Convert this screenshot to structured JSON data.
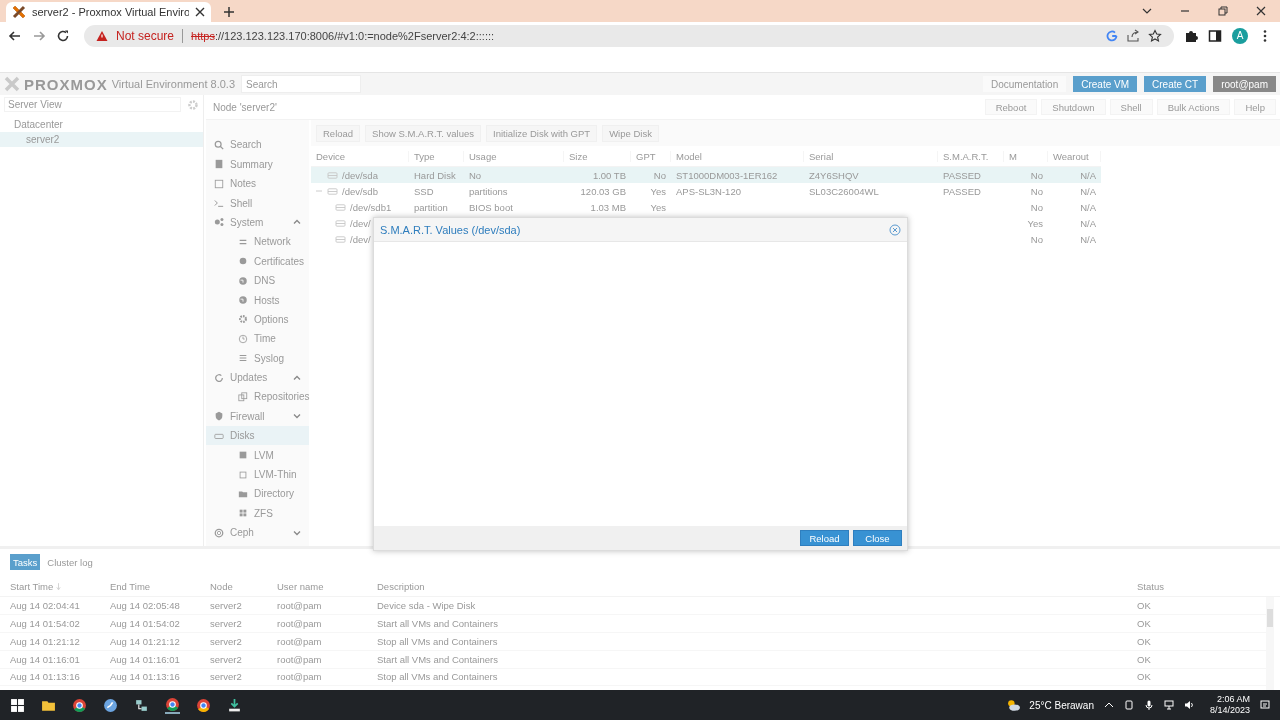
{
  "browser": {
    "tab_title": "server2 - Proxmox Virtual Enviro",
    "security": "Not secure",
    "url_scheme": "https",
    "url_rest": "://123.123.123.170:8006/#v1:0:=node%2Fserver2:4:2::::::",
    "avatar": "A"
  },
  "header": {
    "logo": "PROXMOX",
    "product": "Virtual Environment 8.0.3",
    "search": {
      "placeholder": "Search"
    },
    "buttons": [
      {
        "label": "Documentation",
        "kind": "plain"
      },
      {
        "label": "Create VM",
        "kind": "primary"
      },
      {
        "label": "Create CT",
        "kind": "primary"
      },
      {
        "label": "root@pam",
        "kind": "user"
      }
    ]
  },
  "tree": {
    "view": "Server View",
    "items": [
      {
        "label": "Datacenter",
        "selected": false,
        "children": [
          {
            "label": "server2",
            "selected": true
          }
        ]
      }
    ]
  },
  "node": {
    "title": "Node 'server2'",
    "buttons": [
      "Reboot",
      "Shutdown",
      "Shell",
      "Bulk Actions",
      "Help"
    ]
  },
  "nav": {
    "items": [
      {
        "label": "Search",
        "selected": false
      },
      {
        "label": "Summary",
        "selected": false
      },
      {
        "label": "Notes",
        "selected": false
      },
      {
        "label": "Shell",
        "selected": false
      },
      {
        "label": "System",
        "selected": false,
        "expanded": true,
        "children": [
          {
            "label": "Network",
            "selected": false
          },
          {
            "label": "Certificates",
            "selected": false
          },
          {
            "label": "DNS",
            "selected": false
          },
          {
            "label": "Hosts",
            "selected": false
          },
          {
            "label": "Options",
            "selected": false
          },
          {
            "label": "Time",
            "selected": false
          },
          {
            "label": "Syslog",
            "selected": false
          }
        ]
      },
      {
        "label": "Updates",
        "selected": false,
        "expanded": true,
        "children": [
          {
            "label": "Repositories",
            "selected": false
          }
        ]
      },
      {
        "label": "Firewall",
        "selected": false,
        "expanded": false
      },
      {
        "label": "Disks",
        "selected": true,
        "children": [
          {
            "label": "LVM",
            "selected": false
          },
          {
            "label": "LVM-Thin",
            "selected": false
          },
          {
            "label": "Directory",
            "selected": false
          },
          {
            "label": "ZFS",
            "selected": false
          }
        ]
      },
      {
        "label": "Ceph",
        "selected": false,
        "expanded": false
      }
    ]
  },
  "disks": {
    "toolbar": [
      "Reload",
      "Show S.M.A.R.T. values",
      "Initialize Disk with GPT",
      "Wipe Disk"
    ],
    "columns": [
      "Device",
      "Type",
      "Usage",
      "Size",
      "GPT",
      "Model",
      "Serial",
      "S.M.A.R.T.",
      "M",
      "Wearout"
    ],
    "rows": [
      {
        "device": "/dev/sda",
        "type": "Hard Disk",
        "usage": "No",
        "size": "1.00 TB",
        "gpt": "No",
        "model": "ST1000DM003-1ER162",
        "serial": "Z4Y6SHQV",
        "smart": "PASSED",
        "m": "No",
        "wearout": "N/A",
        "selected": true
      },
      {
        "device": "/dev/sdb",
        "type": "SSD",
        "usage": "partitions",
        "size": "120.03 GB",
        "gpt": "Yes",
        "model": "APS-SL3N-120",
        "serial": "SL03C26004WL",
        "smart": "PASSED",
        "m": "No",
        "wearout": "N/A",
        "selected": false,
        "expanded": true,
        "children": [
          {
            "device": "/dev/sdb1",
            "type": "partition",
            "usage": "BIOS boot",
            "size": "1.03 MB",
            "gpt": "Yes",
            "m": "No",
            "wearout": "N/A",
            "selected": false
          },
          {
            "device": "/dev/",
            "m": "Yes",
            "wearout": "N/A",
            "selected": false
          },
          {
            "device": "/dev/",
            "m": "No",
            "wearout": "N/A",
            "selected": false
          }
        ]
      }
    ]
  },
  "dialog": {
    "title": "S.M.A.R.T. Values (/dev/sda)",
    "buttons": [
      "Reload",
      "Close"
    ]
  },
  "tasks": {
    "tabs": [
      {
        "label": "Tasks",
        "selected": true
      },
      {
        "label": "Cluster log",
        "selected": false
      }
    ],
    "columns": [
      "Start Time",
      "End Time",
      "Node",
      "User name",
      "Description",
      "Status"
    ],
    "rows": [
      [
        "Aug 14 02:04:41",
        "Aug 14 02:05:48",
        "server2",
        "root@pam",
        "Device sda - Wipe Disk",
        "OK"
      ],
      [
        "Aug 14 01:54:02",
        "Aug 14 01:54:02",
        "server2",
        "root@pam",
        "Start all VMs and Containers",
        "OK"
      ],
      [
        "Aug 14 01:21:12",
        "Aug 14 01:21:12",
        "server2",
        "root@pam",
        "Stop all VMs and Containers",
        "OK"
      ],
      [
        "Aug 14 01:16:01",
        "Aug 14 01:16:01",
        "server2",
        "root@pam",
        "Start all VMs and Containers",
        "OK"
      ],
      [
        "Aug 14 01:13:16",
        "Aug 14 01:13:16",
        "server2",
        "root@pam",
        "Stop all VMs and Containers",
        "OK"
      ]
    ]
  },
  "taskbar": {
    "weather": "25°C Berawan",
    "time": "2:06 AM",
    "date": "8/14/2023"
  }
}
